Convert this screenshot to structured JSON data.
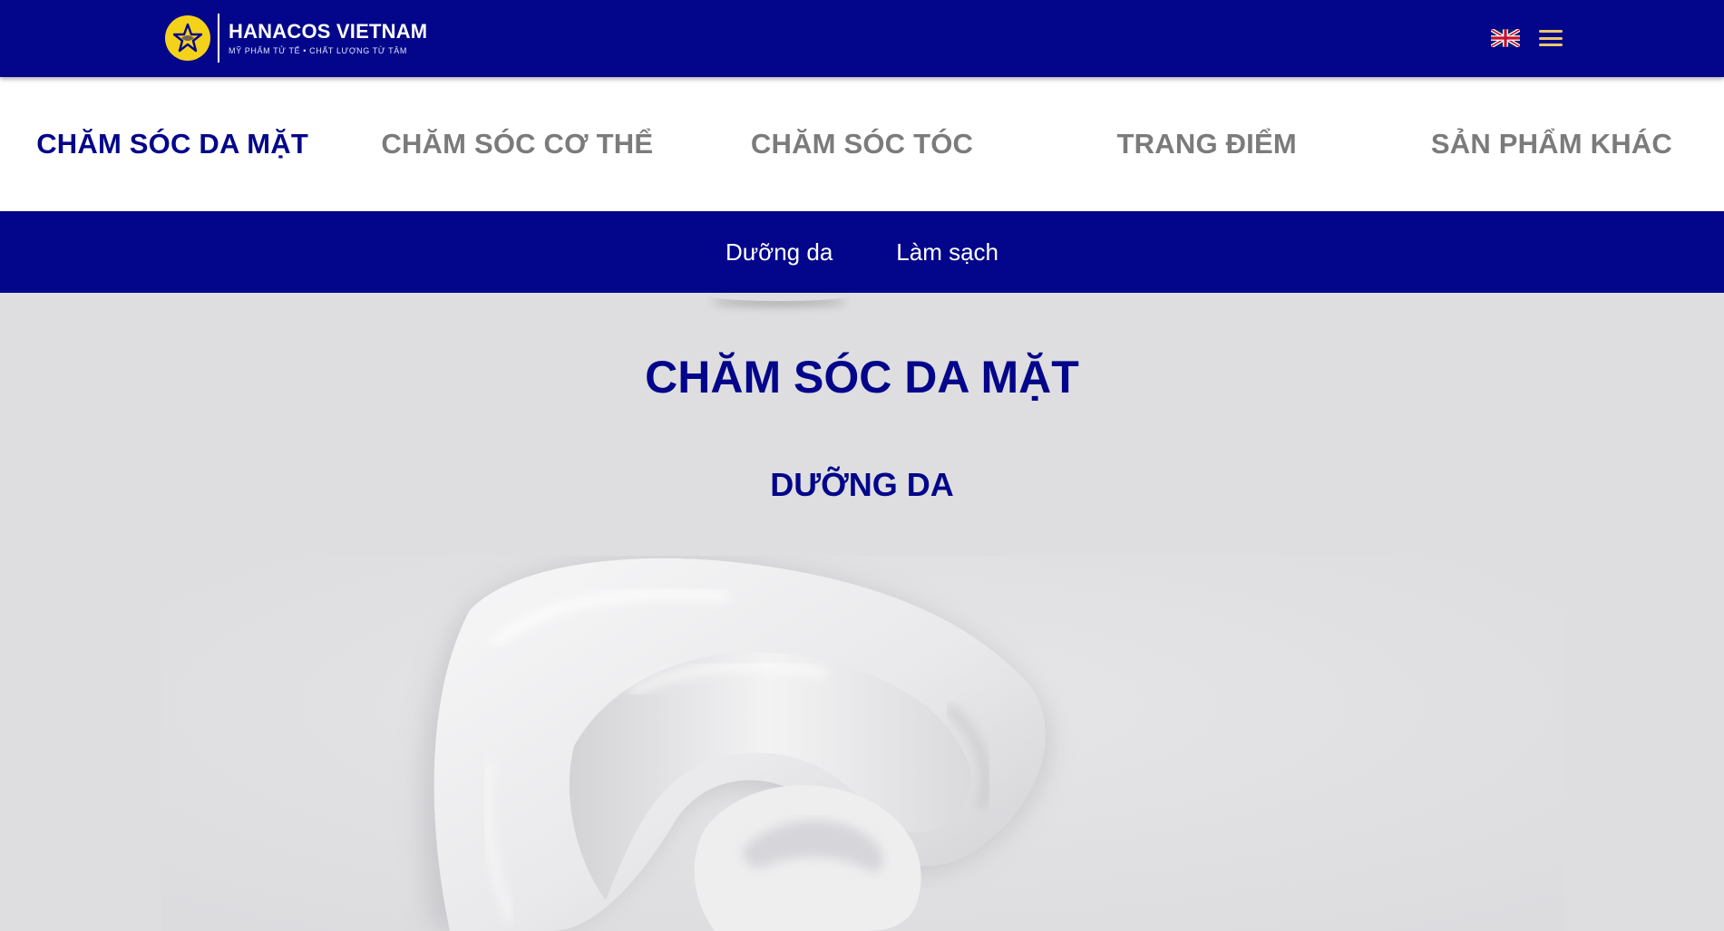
{
  "header": {
    "brand": "HANACOS VIETNAM",
    "tagline": "MỸ PHẨM TỬ TẾ • CHẤT LƯỢNG TỪ TÂM",
    "logo_icon": "star-logo-icon",
    "language_icon": "uk-flag-icon",
    "menu_icon": "hamburger-menu-icon",
    "colors": {
      "primary": "#03068a",
      "accent": "#f5d21a",
      "menu": "#e9c86b"
    }
  },
  "categories": [
    {
      "label": "CHĂM SÓC DA MẶT",
      "active": true
    },
    {
      "label": "CHĂM SÓC CƠ THỂ",
      "active": false
    },
    {
      "label": "CHĂM SÓC TÓC",
      "active": false
    },
    {
      "label": "TRANG ĐIỂM",
      "active": false
    },
    {
      "label": "SẢN PHẨM KHÁC",
      "active": false
    }
  ],
  "subcategories": [
    {
      "label": "Dưỡng da",
      "active": true
    },
    {
      "label": "Làm sạch",
      "active": false
    }
  ],
  "main": {
    "title": "CHĂM SÓC DA MẶT",
    "section_title": "DƯỠNG DA",
    "hero_image": "cream-texture-image"
  }
}
